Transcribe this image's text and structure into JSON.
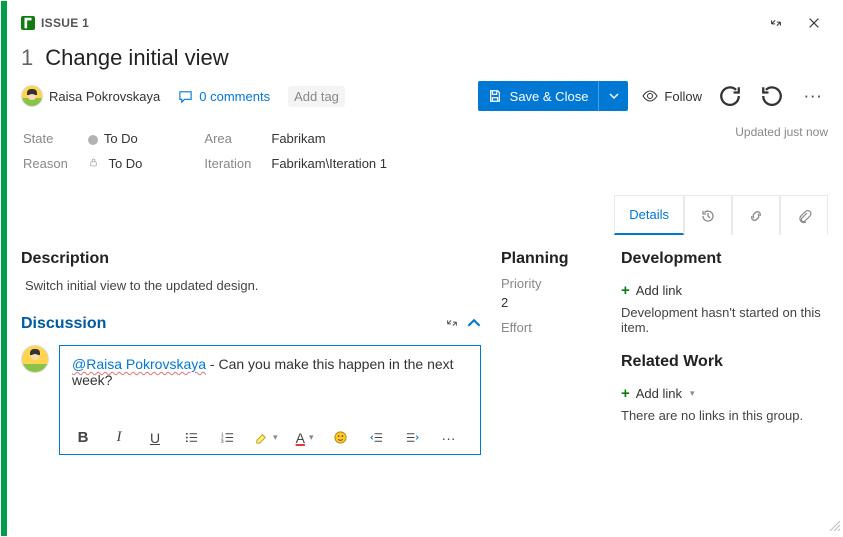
{
  "header": {
    "type_label": "ISSUE 1",
    "number": "1",
    "title": "Change initial view"
  },
  "user": {
    "display_name": "Raisa Pokrovskaya"
  },
  "comments": {
    "count_label": "0 comments"
  },
  "tags": {
    "add_label": "Add tag"
  },
  "buttons": {
    "save_close": "Save & Close",
    "follow": "Follow"
  },
  "meta": {
    "state_label": "State",
    "state_value": "To Do",
    "reason_label": "Reason",
    "reason_value": "To Do",
    "area_label": "Area",
    "area_value": "Fabrikam",
    "iteration_label": "Iteration",
    "iteration_value": "Fabrikam\\Iteration 1",
    "updated": "Updated just now"
  },
  "tabs": {
    "details": "Details"
  },
  "description": {
    "heading": "Description",
    "body": "Switch initial view to the updated design."
  },
  "discussion": {
    "heading": "Discussion",
    "mention": "@Raisa Pokrovskaya",
    "body": " - Can you make this happen in the next week?"
  },
  "planning": {
    "heading": "Planning",
    "priority_label": "Priority",
    "priority_value": "2",
    "effort_label": "Effort"
  },
  "development": {
    "heading": "Development",
    "add_link": "Add link",
    "note": "Development hasn't started on this item."
  },
  "related": {
    "heading": "Related Work",
    "add_link": "Add link",
    "note": "There are no links in this group."
  }
}
